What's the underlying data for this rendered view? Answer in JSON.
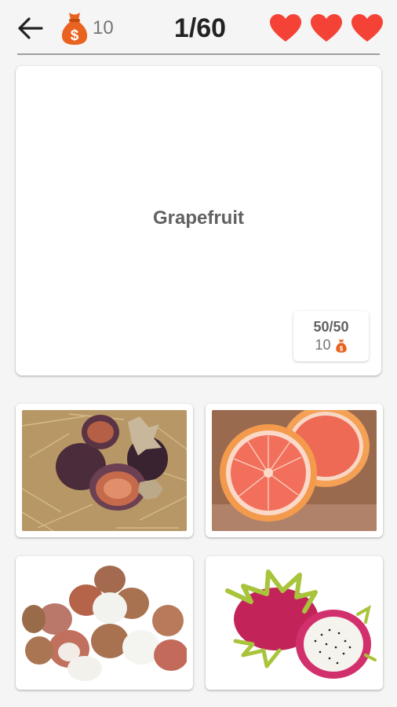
{
  "header": {
    "coins": "10",
    "progress": "1/60",
    "lives": 3,
    "colors": {
      "heart": "#f44336",
      "bag": "#e9621f"
    }
  },
  "question": {
    "word": "Grapefruit",
    "points": "50/50",
    "reward": "10"
  },
  "answers": [
    {
      "subject": "figs-image"
    },
    {
      "subject": "grapefruit-image"
    },
    {
      "subject": "lychee-image"
    },
    {
      "subject": "dragon-fruit-image"
    }
  ]
}
